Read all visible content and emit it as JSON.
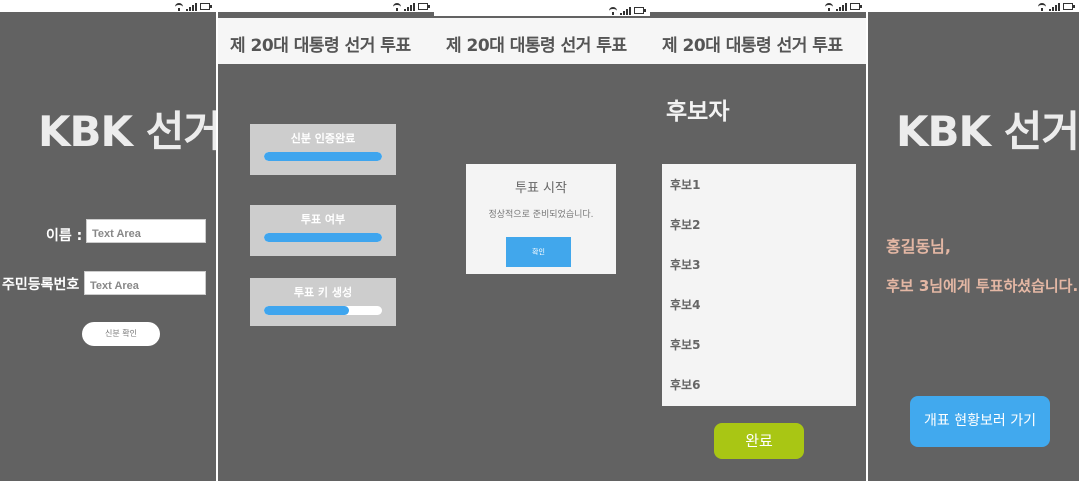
{
  "colors": {
    "screen_bg": "#626262",
    "accent_blue": "#41a7ec",
    "accent_green": "#a9c614",
    "result_text": "#e4b7a4"
  },
  "status_icons": [
    "wifi-icon",
    "signal-icon",
    "battery-icon"
  ],
  "screen1": {
    "title": "KBK 선거",
    "name_label": "이름 :",
    "name_placeholder": "Text Area",
    "id_label": "주민등록번호 :",
    "id_placeholder": "Text Area",
    "verify_button": "신분 확인"
  },
  "screen2": {
    "header": "제 20대 대통령 선거 투표",
    "steps": [
      {
        "label": "신분 인증완료",
        "progress": 1.0
      },
      {
        "label": "투표 여부",
        "progress": 1.0
      },
      {
        "label": "투표 키 생성",
        "progress": 0.72
      }
    ]
  },
  "screen3": {
    "header": "제 20대 대통령 선거 투표",
    "dialog_title": "투표 시작",
    "dialog_message": "정상적으로 준비되었습니다.",
    "dialog_button": "확인"
  },
  "screen4": {
    "header": "제 20대 대통령 선거 투표",
    "heading": "후보자",
    "candidates": [
      "후보1",
      "후보2",
      "후보3",
      "후보4",
      "후보5",
      "후보6"
    ],
    "done_button": "완료"
  },
  "screen5": {
    "title": "KBK 선거",
    "greeting": "홍길동님,",
    "message": "후보 3님에게 투표하셨습니다.",
    "results_button": "개표 현황보러 가기"
  }
}
